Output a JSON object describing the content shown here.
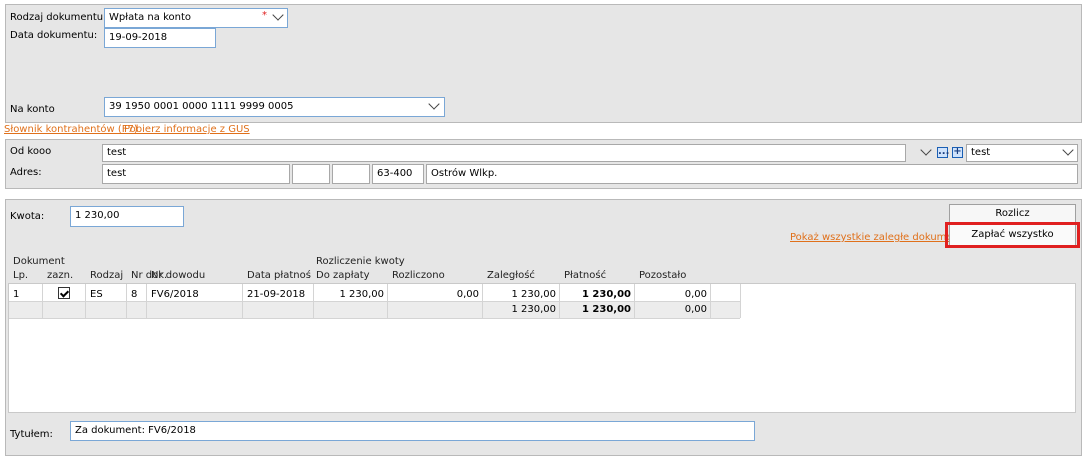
{
  "form": {
    "doc_type_label": "Rodzaj dokumentu:",
    "doc_type_value": "Wpłata na konto",
    "doc_date_label": "Data dokumentu:",
    "doc_date_value": "19-09-2018",
    "account_label": "Na konto",
    "account_value": "39 1950 0001 0000 1111 9999 0005",
    "required_marker": "*"
  },
  "links": {
    "contractors": "Słownik kontrahentów (F7)",
    "gus": "Pobierz informacje z GUS",
    "show_overdue": "Pokaż wszystkie zaległe dokumenty"
  },
  "payer": {
    "from_label": "Od kooo",
    "from_value": "test",
    "from_select_value": "test",
    "address_label": "Adres:",
    "address_value": "test",
    "addr_field2": "",
    "addr_field3": "",
    "postal_code": "63-400",
    "city": "Ostrów Wlkp.",
    "more_btn": "...",
    "add_btn": "+"
  },
  "payment": {
    "amount_label": "Kwota:",
    "amount_value": "1 230,00",
    "settle_button": "Rozlicz",
    "pay_all_button": "Zapłać wszystko",
    "title_label": "Tytułem:",
    "title_value": "Za dokument: FV6/2018"
  },
  "table": {
    "group_document": "Dokument",
    "group_settlement": "Rozliczenie kwoty",
    "headers": {
      "lp": "Lp.",
      "zazn": "zazn.",
      "rodzaj": "Rodzaj",
      "nr_dok": "Nr dok.",
      "nr_dowodu": "Nr dowodu",
      "data_platnosci": "Data płatnoś",
      "do_zaplaty": "Do zapłaty",
      "rozliczono": "Rozliczono",
      "zaleglosc": "Zaległość",
      "platnosc": "Płatność",
      "pozostalo": "Pozostało"
    },
    "rows": [
      {
        "lp": "1",
        "rodzaj": "ES",
        "nr_dok": "8",
        "nr_dowodu": "FV6/2018",
        "data_platnosci": "21-09-2018",
        "do_zaplaty": "1 230,00",
        "rozliczono": "0,00",
        "zaleglosc": "1 230,00",
        "platnosc": "1 230,00",
        "pozostalo": "0,00"
      }
    ],
    "summary": {
      "zaleglosc": "1 230,00",
      "platnosc": "1 230,00",
      "pozostalo": "0,00"
    }
  },
  "colors": {
    "panel": "#e6e6e6",
    "link": "#e0701a",
    "highlight": "#e02020",
    "field_border": "#7aa7d6"
  }
}
